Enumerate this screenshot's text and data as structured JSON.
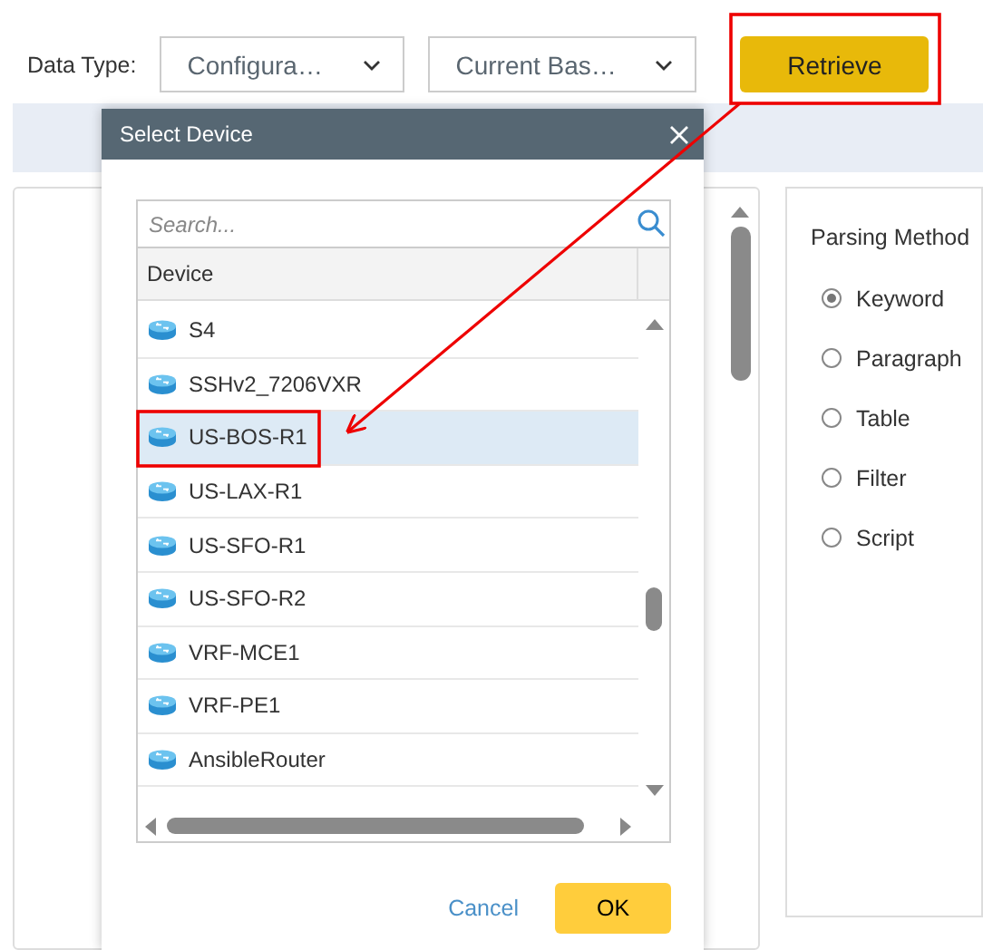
{
  "toolbar": {
    "label": "Data Type:",
    "dropdowns": [
      {
        "value": "Configura…"
      },
      {
        "value": "Current Bas…"
      }
    ],
    "retrieve_button": "Retrieve"
  },
  "dialog": {
    "title": "Select Device",
    "search": {
      "placeholder": "Search..."
    },
    "column": "Device",
    "devices": [
      {
        "name": "S4",
        "selected": false
      },
      {
        "name": "SSHv2_7206VXR",
        "selected": false
      },
      {
        "name": "US-BOS-R1",
        "selected": true
      },
      {
        "name": "US-LAX-R1",
        "selected": false
      },
      {
        "name": "US-SFO-R1",
        "selected": false
      },
      {
        "name": "US-SFO-R2",
        "selected": false
      },
      {
        "name": "VRF-MCE1",
        "selected": false
      },
      {
        "name": "VRF-PE1",
        "selected": false
      },
      {
        "name": "AnsibleRouter",
        "selected": false
      }
    ],
    "cancel_button": "Cancel",
    "ok_button": "OK"
  },
  "parsing_panel": {
    "title": "Parsing Method",
    "options": [
      {
        "label": "Keyword",
        "selected": true
      },
      {
        "label": "Paragraph",
        "selected": false
      },
      {
        "label": "Table",
        "selected": false
      },
      {
        "label": "Filter",
        "selected": false
      },
      {
        "label": "Script",
        "selected": false
      }
    ]
  }
}
